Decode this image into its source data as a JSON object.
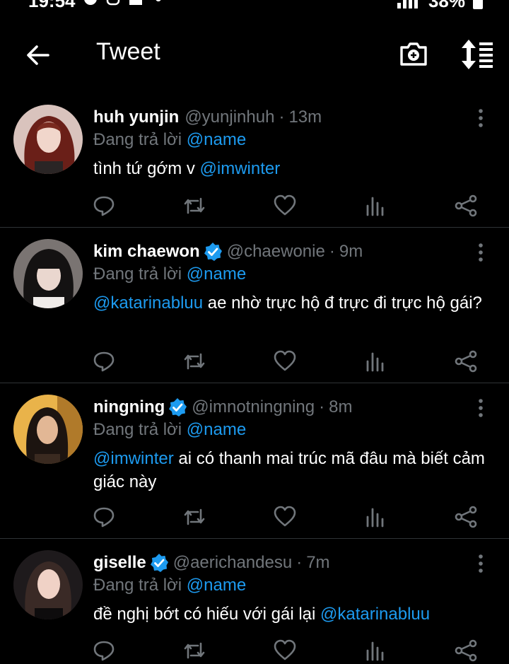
{
  "status_bar": {
    "time": "19:54",
    "battery": "38%"
  },
  "header": {
    "title": "Tweet"
  },
  "tweets": [
    {
      "display_name": "huh yunjin",
      "verified": false,
      "handle": "@yunjinhuh",
      "time": "13m",
      "reply_prefix": "Đang trả lời",
      "reply_to": "@name",
      "mention_before": "",
      "text": "tình tứ gớm v ",
      "mention_after": "@imwinter"
    },
    {
      "display_name": "kim chaewon",
      "verified": true,
      "handle": "@chaewonie",
      "time": "9m",
      "reply_prefix": "Đang trả lời",
      "reply_to": "@name",
      "mention_before": "@katarinabluu",
      "text": " ae nhờ trực hộ đ trực đi trực hộ gái?",
      "mention_after": ""
    },
    {
      "display_name": "ningning",
      "verified": true,
      "handle": "@imnotningning",
      "time": "8m",
      "reply_prefix": "Đang trả lời",
      "reply_to": "@name",
      "mention_before": "@imwinter",
      "text": " ai có thanh mai trúc mã đâu mà biết cảm giác này",
      "mention_after": ""
    },
    {
      "display_name": "giselle",
      "verified": true,
      "handle": "@aerichandesu",
      "time": "7m",
      "reply_prefix": "Đang trả lời",
      "reply_to": "@name",
      "mention_before": "",
      "text": "đề nghị bớt có hiếu với gái lại ",
      "mention_after": "@katarinabluu"
    }
  ],
  "icons": {
    "reply": "reply-icon",
    "retweet": "retweet-icon",
    "like": "like-icon",
    "views": "views-icon",
    "share": "share-icon"
  },
  "colors": {
    "background": "#000000",
    "accent": "#1d9bf0",
    "muted": "#71767b",
    "text": "#ffffff"
  }
}
